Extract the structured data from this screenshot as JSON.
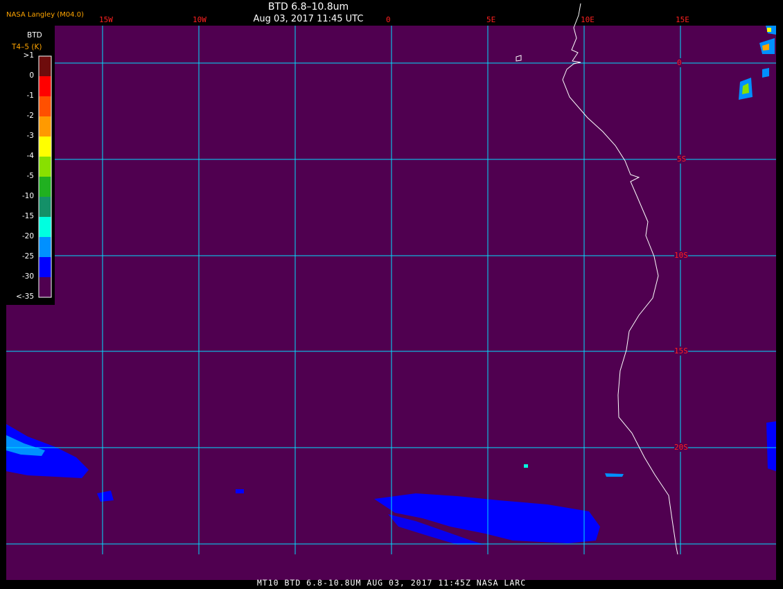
{
  "header": {
    "title": "BTD 6.8–10.8um",
    "datetime": "Aug 03, 2017 11:45 UTC",
    "credit": "NASA Langley (M04.0)"
  },
  "legend": {
    "title": "BTD",
    "units": "T4–5 (K)",
    "labels": [
      ">1",
      "0",
      "-1",
      "-2",
      "-3",
      "-4",
      "-5",
      "-10",
      "-15",
      "-20",
      "-25",
      "-30",
      "<-35"
    ],
    "colors": [
      "#6e0c0c",
      "#ff0000",
      "#ff5000",
      "#ff9a00",
      "#ffff00",
      "#88e000",
      "#20b020",
      "#149068",
      "#00ffe0",
      "#0090ff",
      "#0000ff",
      "#500050"
    ]
  },
  "map": {
    "background_color": "#500050",
    "grid_color": "#00e0ff",
    "coastline_color": "#ffffff",
    "longitude_labels": [
      "15W",
      "10W",
      "0",
      "5E",
      "10E",
      "15E"
    ],
    "latitude_labels": [
      "0",
      "5S",
      "10S",
      "15S",
      "20S"
    ]
  },
  "footer": {
    "text": "MT10  BTD 6.8-10.8UM   AUG 03, 2017 11:45Z   NASA LARC"
  }
}
